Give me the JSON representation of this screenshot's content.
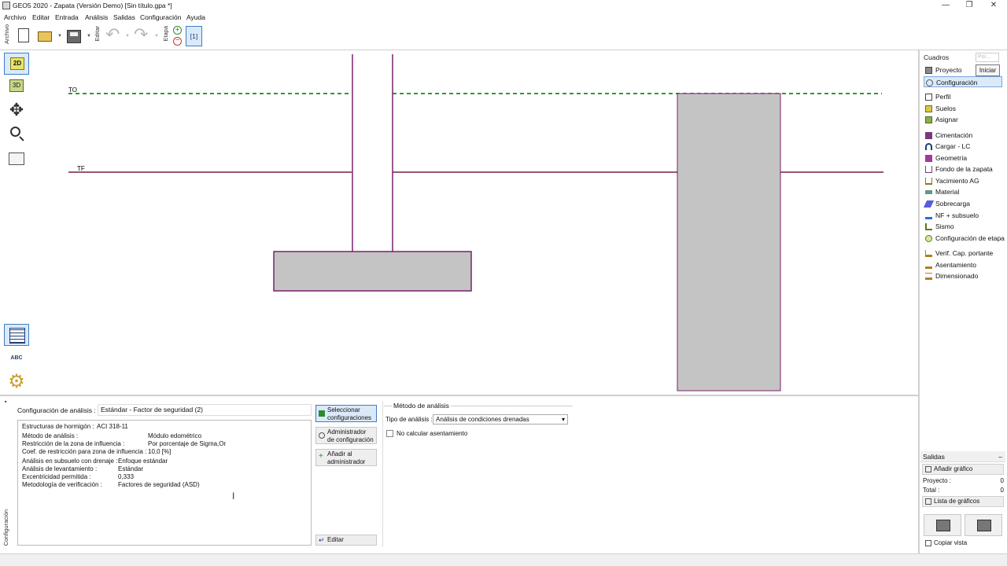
{
  "window": {
    "title": "GEO5 2020 - Zapata (Versión Demo) [Sin título.gpa *]",
    "minimize": "—",
    "restore": "❐",
    "close": "✕"
  },
  "menu": {
    "items": [
      "Archivo",
      "Editar",
      "Entrada",
      "Análisis",
      "Salidas",
      "Configuración",
      "Ayuda"
    ]
  },
  "toolbar": {
    "archivo_label": "Archivo",
    "editar_label": "Editar",
    "etapa_label": "Etapa",
    "stage_tab": "[1]",
    "icons": [
      "new-document-icon",
      "open-folder-icon",
      "save-icon",
      "undo-icon",
      "redo-icon"
    ]
  },
  "left_toolbar": {
    "view_2d": "2D",
    "view_3d": "3D",
    "abc": "ABC"
  },
  "canvas": {
    "label_to": "TO",
    "label_tf": "TF",
    "colors": {
      "water_line": "#2e9a2e",
      "terrain_line": "#7a1f3a",
      "foundation_fill": "#c4c4c4",
      "foundation_stroke": "#7a2070"
    }
  },
  "right_panel": {
    "header": "Cuadros",
    "search_placeholder": "Poi...",
    "tooltip": "Iniciar",
    "group1": [
      "Proyecto",
      "Configuración"
    ],
    "group2": [
      "Perfil",
      "Suelos",
      "Asignar"
    ],
    "group3": [
      "Cimentación",
      "Cargar - LC",
      "Geometría",
      "Fondo de la zapata",
      "Yacimiento AG",
      "Material",
      "Sobrecarga",
      "NF + subsuelo",
      "Sismo",
      "Configuración de etapa"
    ],
    "group4": [
      "Verif. Cap. portante",
      "Asentamiento",
      "Dimensionado"
    ],
    "selected": "Configuración"
  },
  "outputs": {
    "header": "Salidas",
    "collapse": "–",
    "add_graphic": "Añadir gráfico",
    "project_label": "Proyecto :",
    "project_value": "0",
    "total_label": "Total :",
    "total_value": "0",
    "graphics_list": "Lista de gráficos",
    "copy_view": "Copiar vista"
  },
  "bottom_panel": {
    "side_label": "Configuración",
    "config_label": "Configuración de análisis :",
    "config_value": "Estándar - Factor de seguridad (2)",
    "lines": [
      {
        "label": "Estructuras de hormigón :",
        "value": "ACI 318-11"
      },
      {
        "label": "Método de análisis :",
        "value": "Módulo edométrico"
      },
      {
        "label": "Restricción de la zona de influencia :",
        "value": "Por porcentaje de Sigma,Or"
      },
      {
        "label": "Coef. de restricción para zona de influencia :",
        "value": "10,0 [%]"
      },
      {
        "label": "Análisis en subsuelo con drenaje :",
        "value": "Enfoque estándar"
      },
      {
        "label": "Análisis de levantamiento :",
        "value": "Estándar"
      },
      {
        "label": "Excentricidad permitida :",
        "value": "0,333"
      },
      {
        "label": "Metodología de verificación :",
        "value": "Factores de seguridad (ASD)"
      }
    ],
    "btn_select_1": "Seleccionar",
    "btn_select_2": "configuraciones",
    "btn_admin_1": "Administrador",
    "btn_admin_2": "de configuración",
    "btn_add_1": "Añadir al",
    "btn_add_2": "administrador",
    "btn_edit": "Editar",
    "method_group": "Método de análisis",
    "type_label": "Tipo de análisis :",
    "type_value": "Análisis de condiciones drenadas",
    "no_settlement": "No calcular asentamiento"
  }
}
